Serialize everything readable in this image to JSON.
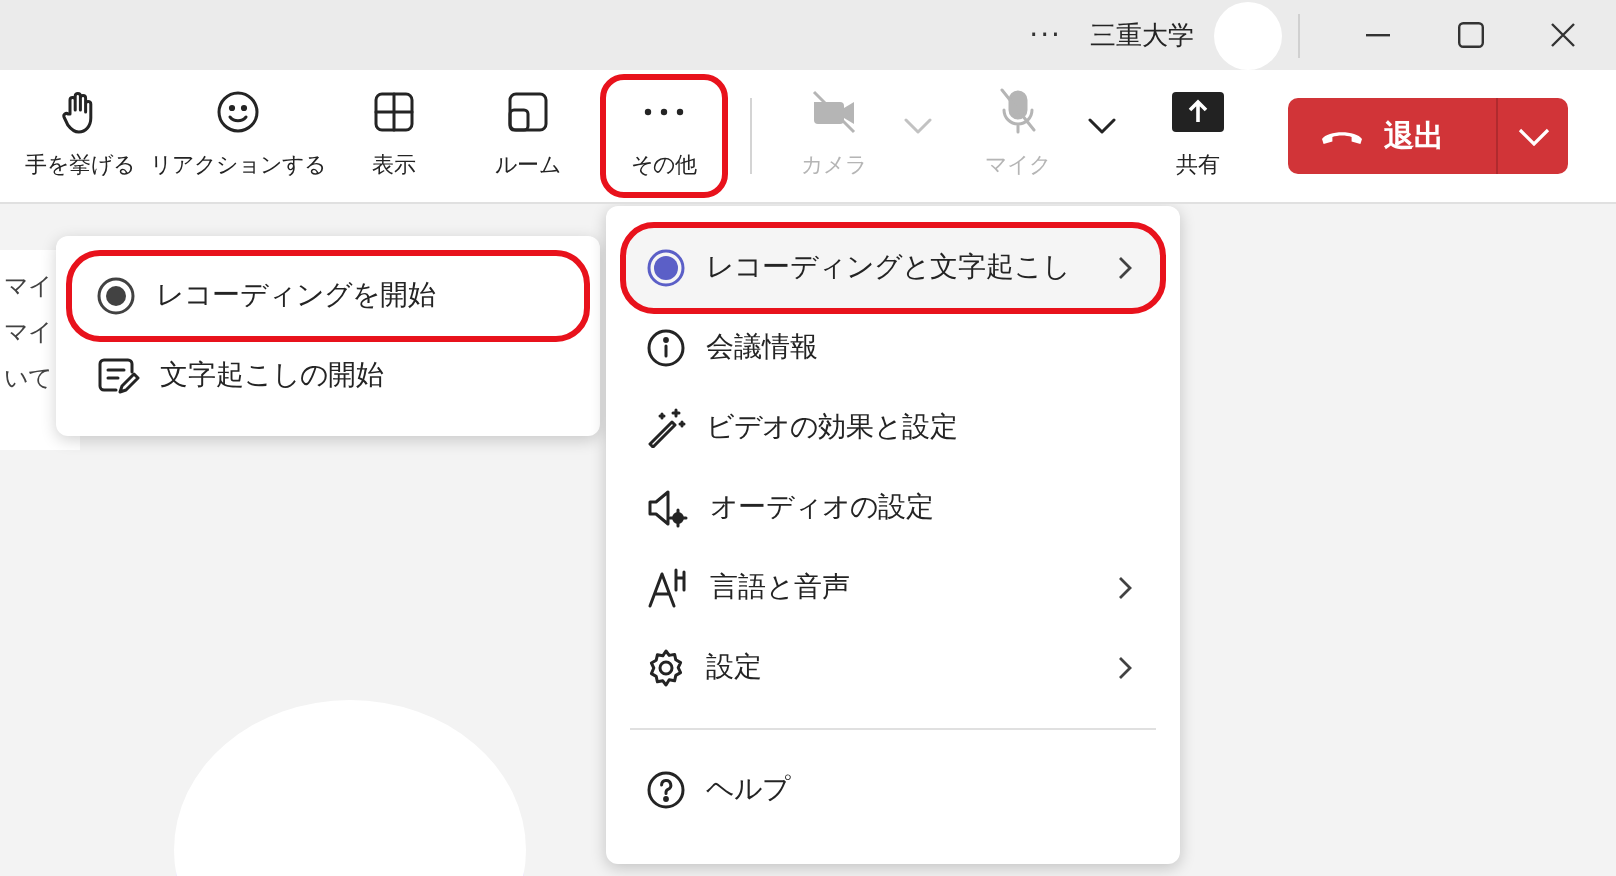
{
  "title_bar": {
    "more": "···",
    "org": "三重大学"
  },
  "toolbar": {
    "items": [
      {
        "kind": "hand",
        "label": "手を挙げる",
        "disabled": false,
        "highlighted": false
      },
      {
        "kind": "smile",
        "label": "リアクションする",
        "disabled": false,
        "highlighted": false
      },
      {
        "kind": "grid",
        "label": "表示",
        "disabled": false,
        "highlighted": false
      },
      {
        "kind": "room",
        "label": "ルーム",
        "disabled": false,
        "highlighted": false
      },
      {
        "kind": "more",
        "label": "その他",
        "disabled": false,
        "highlighted": true
      },
      {
        "kind": "divider"
      },
      {
        "kind": "camera",
        "label": "カメラ",
        "disabled": true,
        "highlighted": false
      },
      {
        "kind": "chevron",
        "disabled": true
      },
      {
        "kind": "mic",
        "label": "マイク",
        "disabled": true,
        "highlighted": false
      },
      {
        "kind": "chevron",
        "disabled": false
      },
      {
        "kind": "share",
        "label": "共有",
        "disabled": false,
        "highlighted": false
      }
    ],
    "leave": {
      "label": "退出"
    }
  },
  "background_panel": {
    "lines": [
      "マイ",
      "マイ",
      "いて"
    ]
  },
  "menu": {
    "items": [
      {
        "kind": "record",
        "label": "レコーディングと文字起こし",
        "submenu": true,
        "hovered": true,
        "highlighted": true
      },
      {
        "kind": "info",
        "label": "会議情報",
        "submenu": false,
        "hovered": false,
        "highlighted": false
      },
      {
        "kind": "wand",
        "label": "ビデオの効果と設定",
        "submenu": false,
        "hovered": false,
        "highlighted": false
      },
      {
        "kind": "speaker",
        "label": "オーディオの設定",
        "submenu": false,
        "hovered": false,
        "highlighted": false
      },
      {
        "kind": "language",
        "label": "言語と音声",
        "submenu": true,
        "hovered": false,
        "highlighted": false
      },
      {
        "kind": "gear",
        "label": "設定",
        "submenu": true,
        "hovered": false,
        "highlighted": false
      },
      {
        "kind": "separator"
      },
      {
        "kind": "help",
        "label": "ヘルプ",
        "submenu": false,
        "hovered": false,
        "highlighted": false
      }
    ]
  },
  "submenu": {
    "items": [
      {
        "kind": "radio",
        "label": "レコーディングを開始",
        "highlighted": true
      },
      {
        "kind": "transcript",
        "label": "文字起こしの開始",
        "highlighted": false
      }
    ]
  }
}
